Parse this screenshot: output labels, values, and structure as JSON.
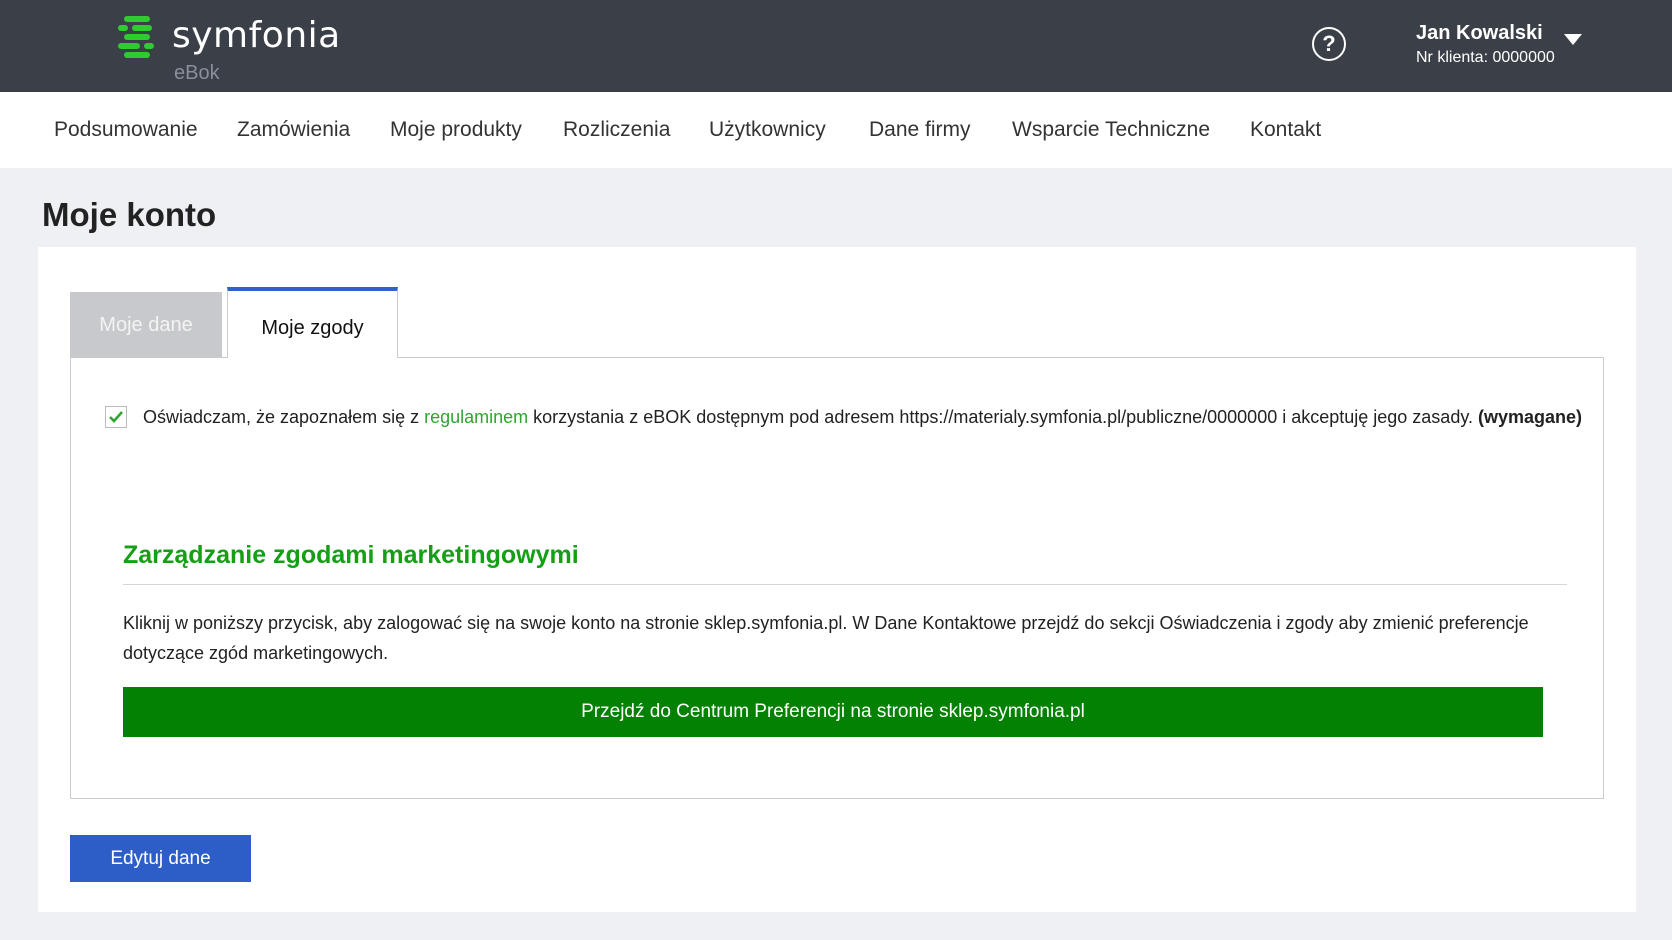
{
  "header": {
    "logo_text": "symfonia",
    "logo_sub": "eBok",
    "help_icon": "question-circle-icon",
    "user_name": "Jan Kowalski",
    "client_number": "Nr klienta: 0000000",
    "accent_color": "#2ecc2e",
    "bg_color": "#3b3f48"
  },
  "nav": {
    "items": [
      {
        "label": "Podsumowanie"
      },
      {
        "label": "Zamówienia"
      },
      {
        "label": "Moje produkty"
      },
      {
        "label": "Rozliczenia"
      },
      {
        "label": "Użytkownicy"
      },
      {
        "label": "Dane firmy"
      },
      {
        "label": "Wsparcie Techniczne"
      },
      {
        "label": "Kontakt"
      }
    ]
  },
  "page": {
    "title": "Moje konto"
  },
  "tabs": [
    {
      "label": "Moje dane",
      "active": false
    },
    {
      "label": "Moje zgody",
      "active": true
    }
  ],
  "consent": {
    "checked": true,
    "text_before": "Oświadczam, że zapoznałem się z ",
    "link_text": "regulaminem",
    "text_after": " korzystania z eBOK dostępnym pod adresem https://materialy.symfonia.pl/publiczne/0000000 i akceptuję jego zasady. ",
    "required": "(wymagane)"
  },
  "marketing": {
    "title": "Zarządzanie zgodami marketingowymi",
    "description": "Kliknij w poniższy przycisk, aby zalogować się na swoje konto na stronie sklep.symfonia.pl. W Dane Kontaktowe przejdź do sekcji Oświadczenia i zgody aby zmienić preferencje dotyczące zgód marketingowych.",
    "button_label": "Przejdź do Centrum Preferencji na stronie sklep.symfonia.pl",
    "button_color": "#028102",
    "title_color": "#14a014"
  },
  "actions": {
    "edit_label": "Edytuj dane",
    "edit_color": "#2d5ec8"
  }
}
